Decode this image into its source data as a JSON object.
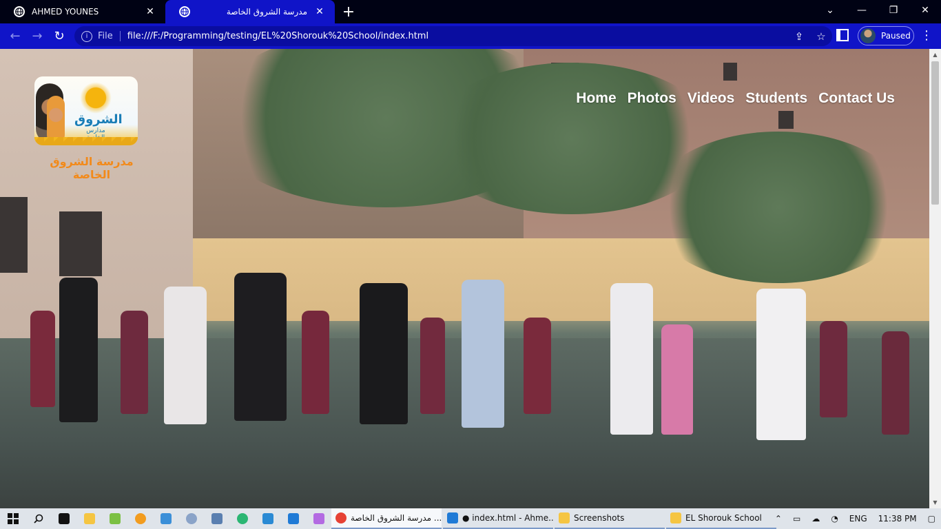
{
  "browser": {
    "tabs": [
      {
        "title": "AHMED YOUNES",
        "active": false
      },
      {
        "title": "مدرسة الشروق الخاصة",
        "active": true
      }
    ],
    "new_tab_glyph": "+",
    "window_controls": {
      "minimize": "—",
      "restore": "❐",
      "close": "✕",
      "tab_search": "⌄"
    },
    "address": {
      "scheme_label": "File",
      "url": "file:///F:/Programming/testing/EL%20Shorouk%20School/index.html"
    },
    "profile": {
      "status": "Paused"
    }
  },
  "page": {
    "logo": {
      "brand": "الشروق",
      "brand_sub": "مدارس الخاصة"
    },
    "school_name": "مدرسة الشروق الخاصة",
    "nav": [
      "Home",
      "Photos",
      "Videos",
      "Students",
      "Contact Us"
    ]
  },
  "taskbar": {
    "tasks": [
      {
        "label": "مدرسة الشروق الخاصة ...",
        "icon": "chrome-icon",
        "color": "#e64235",
        "active": true
      },
      {
        "label": "● index.html - Ahme...",
        "icon": "vscode-icon",
        "color": "#1f7ad6",
        "active": false
      },
      {
        "label": "Screenshots",
        "icon": "folder-icon",
        "color": "#f5c542",
        "active": false
      },
      {
        "label": "EL Shorouk School",
        "icon": "folder-icon",
        "color": "#f5c542",
        "active": false
      }
    ],
    "tray": {
      "language": "ENG",
      "time": "11:38 PM"
    }
  }
}
